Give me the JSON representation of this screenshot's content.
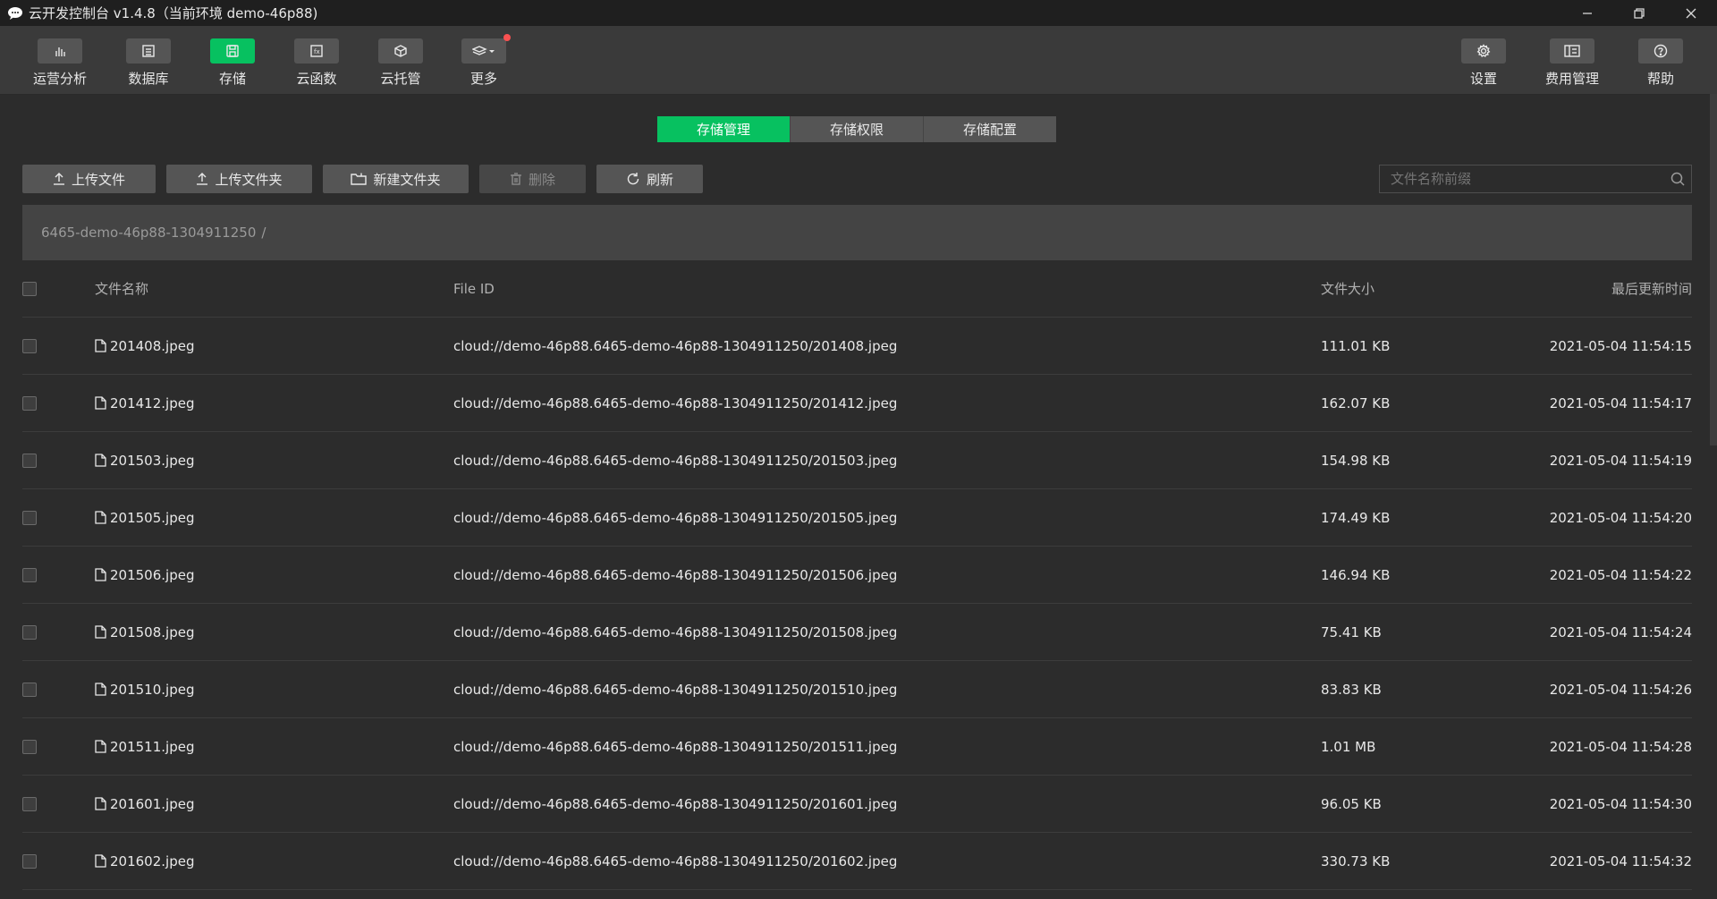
{
  "window": {
    "title": "云开发控制台 v1.4.8（当前环境 demo-46p88)"
  },
  "toolbar": {
    "left": [
      {
        "label": "运营分析",
        "icon": "bar-chart-icon"
      },
      {
        "label": "数据库",
        "icon": "database-icon"
      },
      {
        "label": "存储",
        "icon": "storage-icon",
        "active": true
      },
      {
        "label": "云函数",
        "icon": "function-icon"
      },
      {
        "label": "云托管",
        "icon": "cube-icon"
      },
      {
        "label": "更多",
        "icon": "layers-icon",
        "has_notification": true
      }
    ],
    "right": [
      {
        "label": "设置",
        "icon": "gear-icon"
      },
      {
        "label": "费用管理",
        "icon": "billing-icon"
      },
      {
        "label": "帮助",
        "icon": "help-icon"
      }
    ]
  },
  "tabs": [
    {
      "label": "存储管理",
      "active": true
    },
    {
      "label": "存储权限",
      "active": false
    },
    {
      "label": "存储配置",
      "active": false
    }
  ],
  "actions": {
    "upload_file": "上传文件",
    "upload_folder": "上传文件夹",
    "new_folder": "新建文件夹",
    "delete": "删除",
    "refresh": "刷新"
  },
  "search": {
    "placeholder": "文件名称前缀",
    "value": ""
  },
  "breadcrumb": {
    "path": "6465-demo-46p88-1304911250",
    "separator": "/"
  },
  "table": {
    "columns": {
      "name": "文件名称",
      "file_id": "File ID",
      "size": "文件大小",
      "updated": "最后更新时间"
    },
    "rows": [
      {
        "name": "201408.jpeg",
        "file_id": "cloud://demo-46p88.6465-demo-46p88-1304911250/201408.jpeg",
        "size": "111.01 KB",
        "updated": "2021-05-04 11:54:15"
      },
      {
        "name": "201412.jpeg",
        "file_id": "cloud://demo-46p88.6465-demo-46p88-1304911250/201412.jpeg",
        "size": "162.07 KB",
        "updated": "2021-05-04 11:54:17"
      },
      {
        "name": "201503.jpeg",
        "file_id": "cloud://demo-46p88.6465-demo-46p88-1304911250/201503.jpeg",
        "size": "154.98 KB",
        "updated": "2021-05-04 11:54:19"
      },
      {
        "name": "201505.jpeg",
        "file_id": "cloud://demo-46p88.6465-demo-46p88-1304911250/201505.jpeg",
        "size": "174.49 KB",
        "updated": "2021-05-04 11:54:20"
      },
      {
        "name": "201506.jpeg",
        "file_id": "cloud://demo-46p88.6465-demo-46p88-1304911250/201506.jpeg",
        "size": "146.94 KB",
        "updated": "2021-05-04 11:54:22"
      },
      {
        "name": "201508.jpeg",
        "file_id": "cloud://demo-46p88.6465-demo-46p88-1304911250/201508.jpeg",
        "size": "75.41 KB",
        "updated": "2021-05-04 11:54:24"
      },
      {
        "name": "201510.jpeg",
        "file_id": "cloud://demo-46p88.6465-demo-46p88-1304911250/201510.jpeg",
        "size": "83.83 KB",
        "updated": "2021-05-04 11:54:26"
      },
      {
        "name": "201511.jpeg",
        "file_id": "cloud://demo-46p88.6465-demo-46p88-1304911250/201511.jpeg",
        "size": "1.01 MB",
        "updated": "2021-05-04 11:54:28"
      },
      {
        "name": "201601.jpeg",
        "file_id": "cloud://demo-46p88.6465-demo-46p88-1304911250/201601.jpeg",
        "size": "96.05 KB",
        "updated": "2021-05-04 11:54:30"
      },
      {
        "name": "201602.jpeg",
        "file_id": "cloud://demo-46p88.6465-demo-46p88-1304911250/201602.jpeg",
        "size": "330.73 KB",
        "updated": "2021-05-04 11:54:32"
      }
    ]
  },
  "colors": {
    "accent": "#07c160",
    "background": "#2c2c2c",
    "toolbar": "#3a3a3a",
    "notification": "#fa5151"
  }
}
